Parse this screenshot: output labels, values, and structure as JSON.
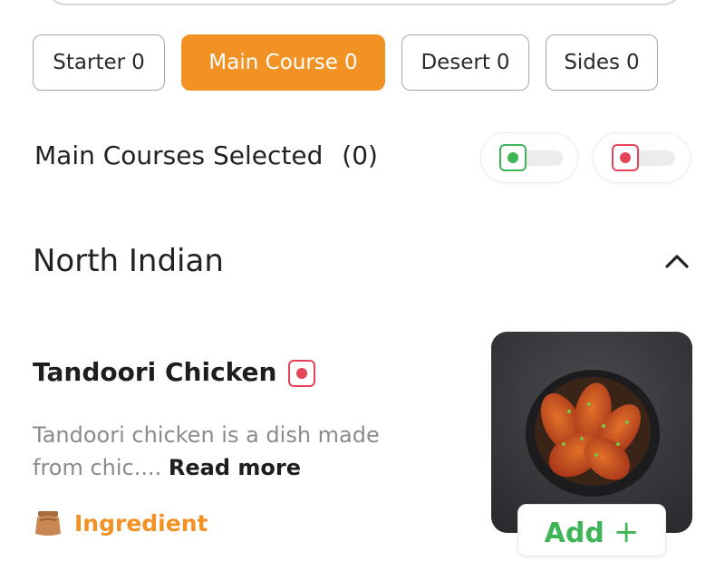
{
  "tabs": [
    {
      "label": "Starter",
      "count": "0",
      "active": false
    },
    {
      "label": "Main Course",
      "count": "0",
      "active": true
    },
    {
      "label": "Desert",
      "count": "0",
      "active": false
    },
    {
      "label": "Sides",
      "count": "0",
      "active": false
    }
  ],
  "selected": {
    "label": "Main Courses Selected",
    "count": "(0)"
  },
  "filters": {
    "veg": "veg-toggle",
    "nonveg": "non-veg-toggle"
  },
  "section": {
    "title": "North Indian",
    "expanded": true
  },
  "dish": {
    "name": "Tandoori Chicken",
    "type": "non-veg",
    "description": "Tandoori chicken is a dish made from chic....",
    "read_more": "Read more",
    "ingredient_label": "Ingredient",
    "add_label": "Add",
    "add_icon": "+"
  },
  "colors": {
    "accent": "#f29224",
    "veg": "#3fb558",
    "nonveg": "#e54458"
  }
}
